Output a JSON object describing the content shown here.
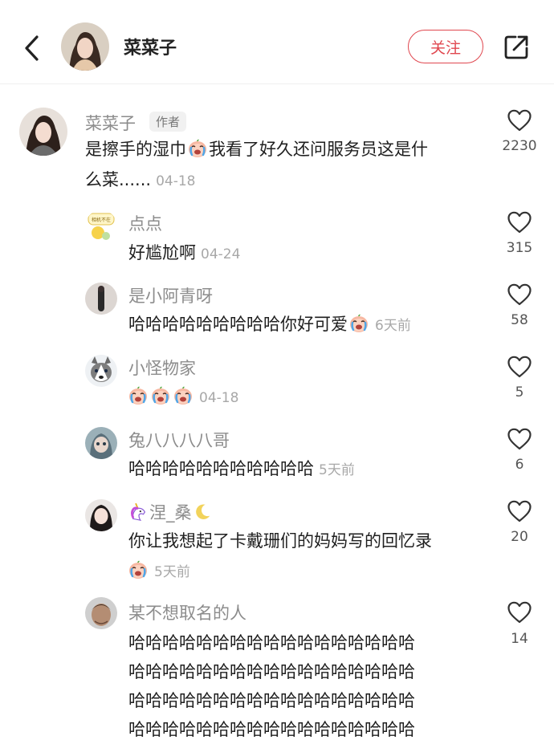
{
  "header": {
    "user_name": "菜菜子",
    "follow_label": "关注"
  },
  "main_comment": {
    "user_name": "菜菜子",
    "author_tag": "作者",
    "text_line1_a": "是擦手的湿巾",
    "text_line1_b": "我看了好久还问服务员这是什",
    "text_line2": "么菜......",
    "date": "04-18",
    "like_count": "2230"
  },
  "replies": [
    {
      "user_name": "点点",
      "avatar_text": "相机不在",
      "text": "好尴尬啊",
      "date": "04-24",
      "like_count": "315"
    },
    {
      "user_name": "是小阿青呀",
      "text": "哈哈哈哈哈哈哈哈哈你好可爱",
      "date": "6天前",
      "like_count": "58"
    },
    {
      "user_name": "小怪物家",
      "text": "",
      "date": "04-18",
      "like_count": "5"
    },
    {
      "user_name": "兔八八八八哥",
      "text": "哈哈哈哈哈哈哈哈哈哈哈",
      "date": "5天前",
      "like_count": "6"
    },
    {
      "user_name": "涅_桑",
      "text": "你让我想起了卡戴珊们的妈妈写的回忆录",
      "date": "5天前",
      "like_count": "20"
    },
    {
      "user_name": "某不想取名的人",
      "lines": [
        "哈哈哈哈哈哈哈哈哈哈哈哈哈哈哈哈哈",
        "哈哈哈哈哈哈哈哈哈哈哈哈哈哈哈哈哈",
        "哈哈哈哈哈哈哈哈哈哈哈哈哈哈哈哈哈",
        "哈哈哈哈哈哈哈哈哈哈哈哈哈哈哈哈哈"
      ],
      "like_count": "14"
    }
  ],
  "colors": {
    "accent": "#e0474f",
    "username": "#8c8c8c",
    "date": "#a8a8a8"
  },
  "icons": [
    "back-arrow-icon",
    "share-icon",
    "heart-icon",
    "crying-laughing-emoji-icon",
    "unicorn-icon",
    "moon-icon"
  ]
}
